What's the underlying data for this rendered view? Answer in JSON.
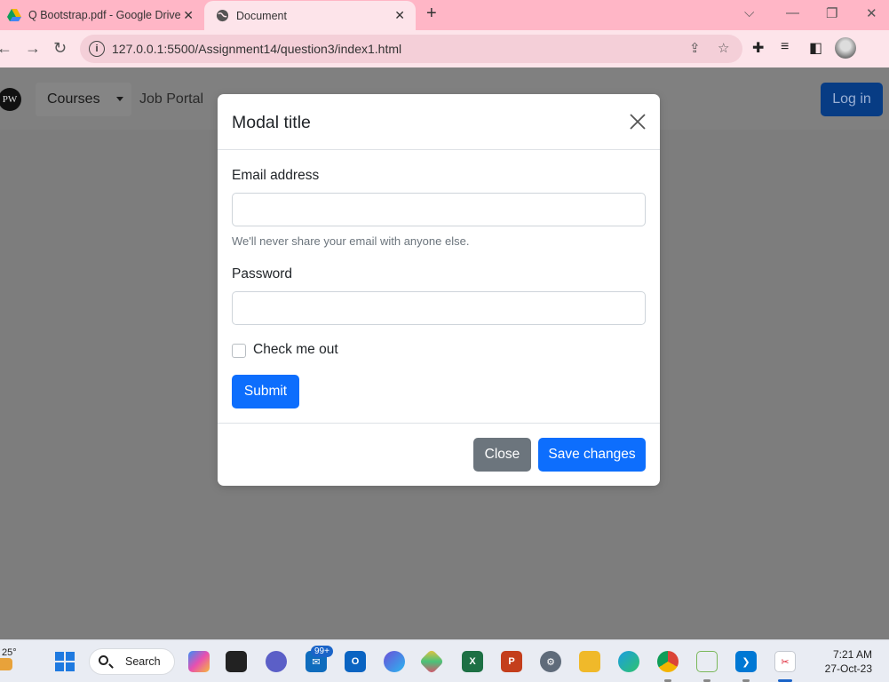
{
  "browser": {
    "tabs": [
      {
        "title": "Q Bootstrap.pdf - Google Drive",
        "icon": "google-drive-icon"
      },
      {
        "title": "Document",
        "icon": "globe-icon"
      }
    ],
    "url": "127.0.0.1:5500/Assignment14/question3/index1.html"
  },
  "navbar": {
    "logo_text": "PW",
    "dropdown_label": "Courses",
    "link": "Job Portal",
    "login_label": "Log in"
  },
  "modal": {
    "title": "Modal title",
    "email_label": "Email address",
    "email_value": "",
    "email_help": "We'll never share your email with anyone else.",
    "password_label": "Password",
    "password_value": "",
    "checkbox_label": "Check me out",
    "checkbox_checked": false,
    "submit_label": "Submit",
    "close_label": "Close",
    "save_label": "Save changes"
  },
  "taskbar": {
    "weather": "25°",
    "search_label": "Search",
    "mail_badge": "99+",
    "time": "7:21 AM",
    "date": "27-Oct-23"
  }
}
